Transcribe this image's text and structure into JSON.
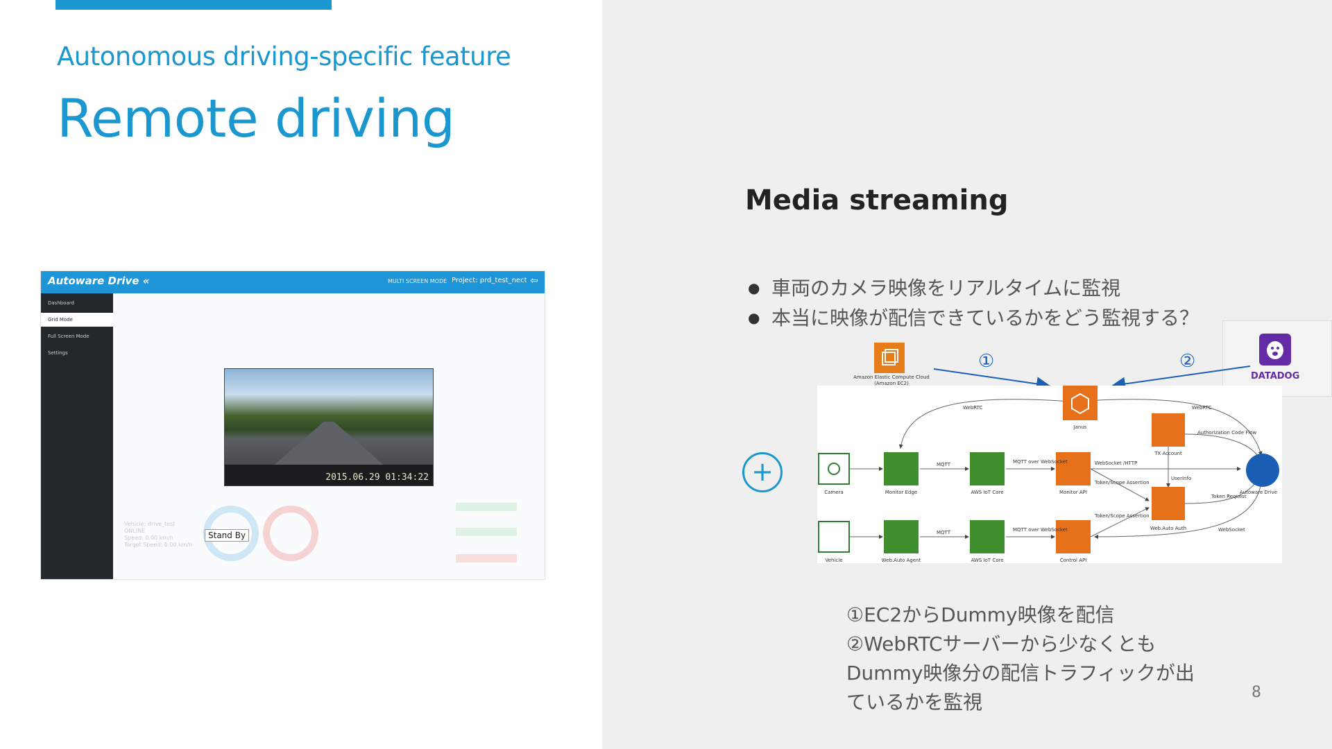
{
  "slide": {
    "kicker": "Autonomous driving-specific feature",
    "title": "Remote driving",
    "page_number": "8",
    "accent_color": "#1a97cf"
  },
  "app_screenshot": {
    "logo": "Autoware Drive «",
    "mode": "MULTI SCREEN MODE",
    "project": "Project: prd_test_nect",
    "sidebar_items": [
      "Dashboard",
      "Grid Mode",
      "Full Screen Mode",
      "Settings"
    ],
    "active_sidebar_item": "Grid Mode",
    "video_timestamp": "2015.06.29 01:34:22",
    "vehicle_info": [
      "Vehicle: drive_test",
      "ONLINE",
      "Speed: 0.00 km/h",
      "Target Speed: 0.00 km/h"
    ],
    "standby_label": "Stand By"
  },
  "media": {
    "heading": "Media streaming",
    "bullets": [
      "車両のカメラ映像をリアルタイムに監視",
      "本当に映像が配信できているかをどう監視する？"
    ],
    "plus_icon": "plus-icon",
    "marker_1": "①",
    "marker_2": "②",
    "ec2_label": "Amazon Elastic Compute Cloud (Amazon EC2)",
    "datadog_label": "DATADOG",
    "notes": [
      "①EC2からDummy映像を配信",
      "②WebRTCサーバーから少なくとも",
      "Dummy映像分の配信トラフィックが出",
      "ているかを監視"
    ]
  },
  "diagram": {
    "nodes": {
      "janus": "Janus",
      "camera": "Camera",
      "monitor_edge": "Monitor Edge",
      "aws_iot_core_1": "AWS IoT Core",
      "monitor_api": "Monitor API",
      "tx_account": "TX Account",
      "autoware_drive": "Autoware Drive",
      "vehicle": "Vehicle",
      "web_auto_agent": "Web.Auto Agent",
      "aws_iot_core_2": "AWS IoT Core",
      "control_api": "Control API",
      "web_auto_auth": "Web.Auto Auth"
    },
    "edges": {
      "webrtc_left": "WebRTC",
      "webrtc_right": "WebRTC",
      "mqtt_1": "MQTT",
      "mqtt_2": "MQTT",
      "mqtt_ws_1": "MQTT over WebSocket",
      "mqtt_ws_2": "MQTT over WebSocket",
      "websocket_http": "WebSocket /HTTP",
      "auth_code_flow": "Authorization Code Flow",
      "token_request": "Token Request",
      "userinfo": "UserInfo",
      "token_scope_1": "Token/Scope Assertion",
      "token_scope_2": "Token/Scope Assertion",
      "websocket": "WebSocket"
    }
  }
}
